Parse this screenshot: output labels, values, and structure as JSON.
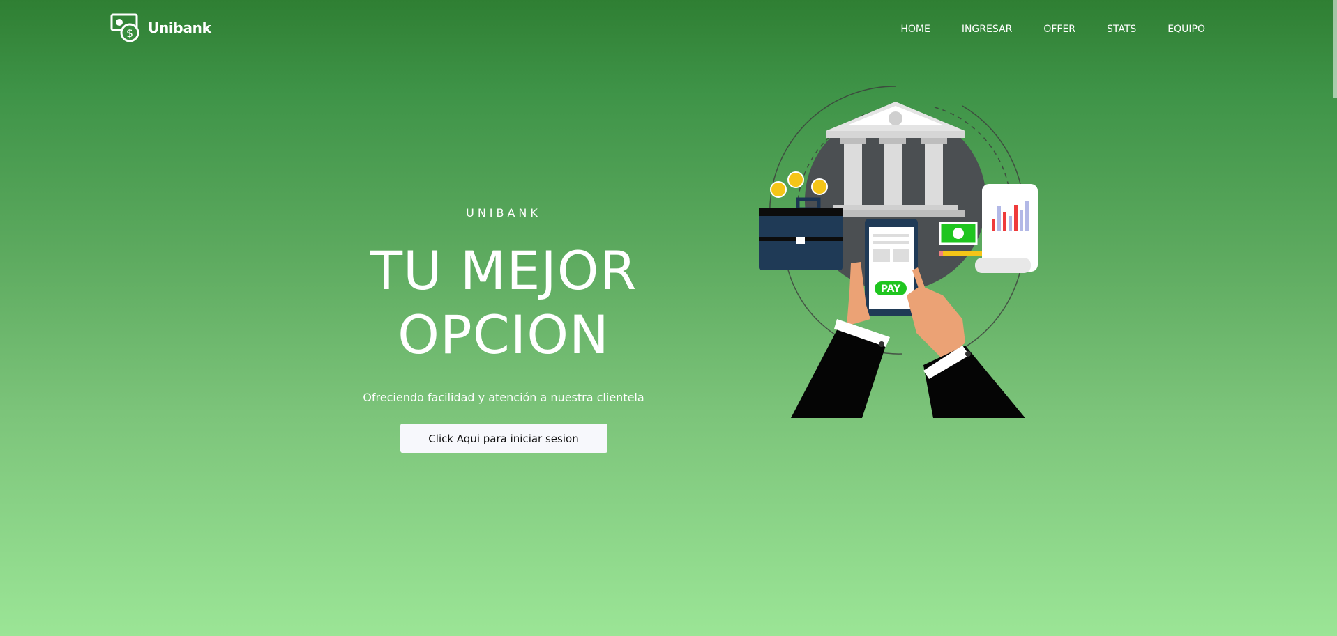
{
  "brand": {
    "name": "Unibank",
    "icon": "money-dollar-icon"
  },
  "nav": {
    "items": [
      {
        "label": "HOME"
      },
      {
        "label": "INGRESAR"
      },
      {
        "label": "OFFER"
      },
      {
        "label": "STATS"
      },
      {
        "label": "EQUIPO"
      }
    ]
  },
  "hero": {
    "eyebrow": "UNIBANK",
    "headline_line1": "TU MEJOR",
    "headline_line2": "OPCION",
    "subtitle": "Ofreciendo facilidad y atención a nuestra clientela",
    "cta_label": "Click Aqui para iniciar sesion"
  },
  "illustration": {
    "name": "bank-payment-illustration",
    "pay_label": "PAY",
    "colors": {
      "circle": "#4b4f52",
      "pay": "#1fc51f",
      "skin": "#eba275",
      "sleeve": "#050505"
    }
  },
  "colors": {
    "bg_top": "#2f7f33",
    "bg_bottom": "#9be596",
    "button_bg": "#f7f8fc"
  }
}
